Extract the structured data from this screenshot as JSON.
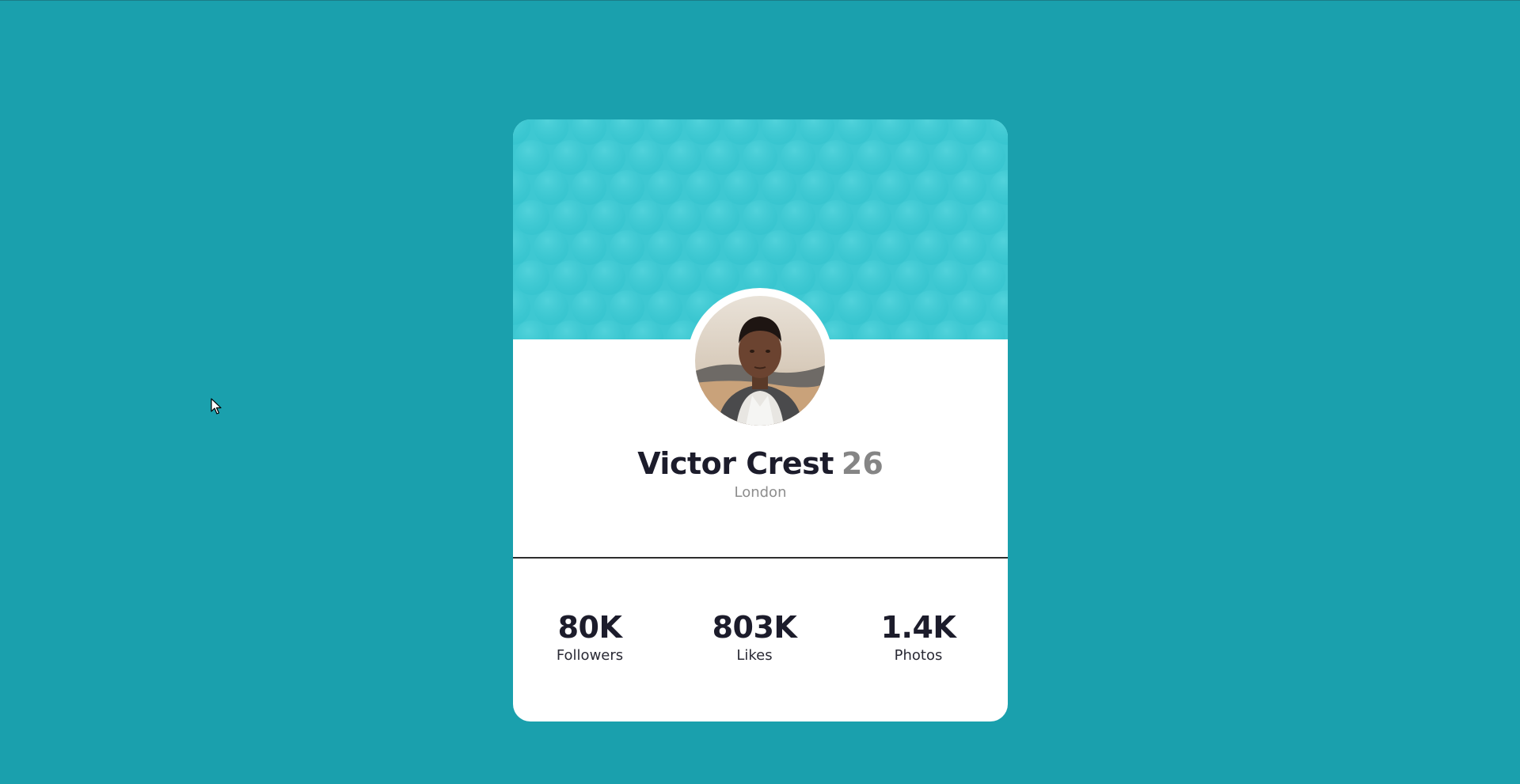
{
  "profile": {
    "name": "Victor Crest",
    "age": "26",
    "location": "London"
  },
  "stats": [
    {
      "value": "80K",
      "label": "Followers"
    },
    {
      "value": "803K",
      "label": "Likes"
    },
    {
      "value": "1.4K",
      "label": "Photos"
    }
  ],
  "colors": {
    "background": "#1aa0ad",
    "banner": "#3ec8d2",
    "card": "#ffffff",
    "name_text": "#1c1c2b",
    "muted_text": "#8d8d8d"
  }
}
